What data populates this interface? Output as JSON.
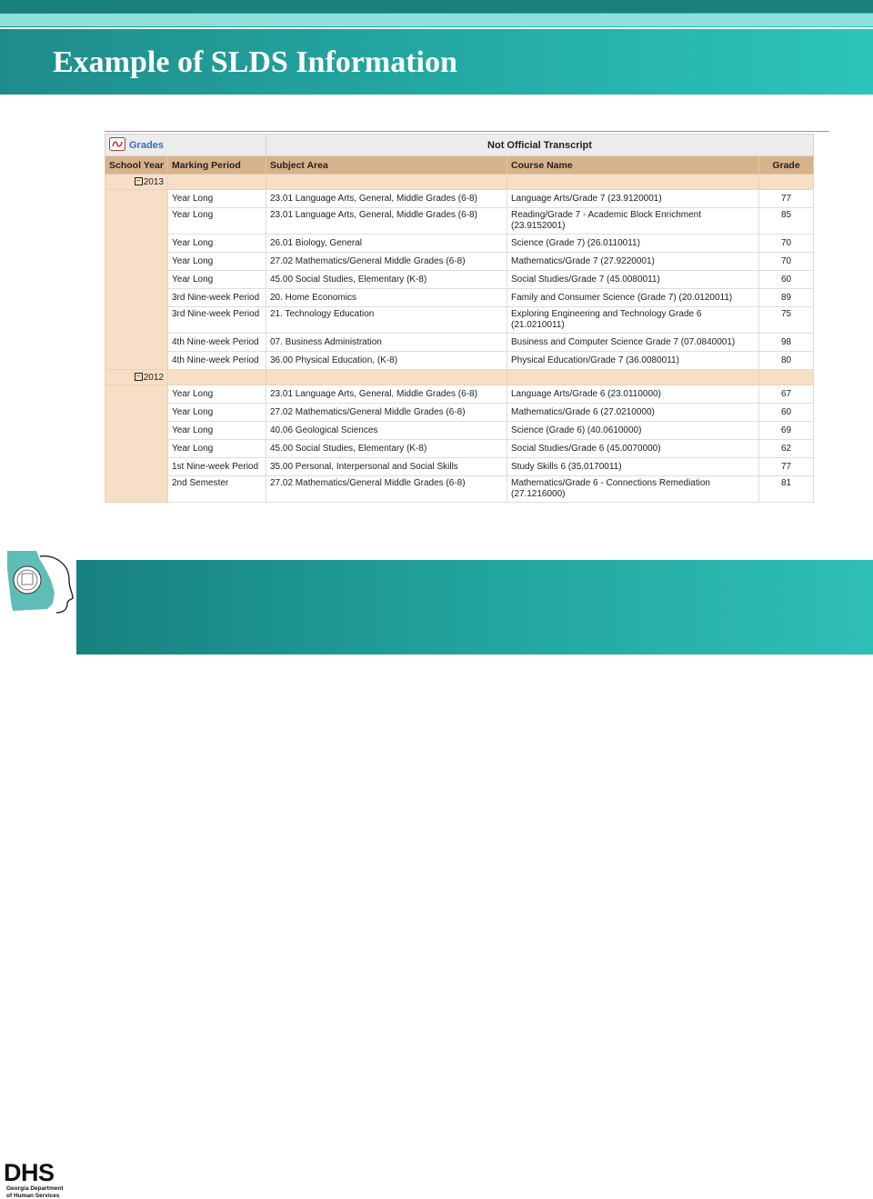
{
  "slide": {
    "title": "Example of SLDS Information"
  },
  "logo": {
    "name": "DHS",
    "org_line1": "Georgia Department",
    "org_line2": "of Human Services"
  },
  "panel": {
    "section_title": "Grades",
    "transcript_label": "Not Official Transcript",
    "columns": [
      "School Year",
      "Marking Period",
      "Subject Area",
      "Course Name",
      "Grade"
    ],
    "years": [
      {
        "year": "2013",
        "rows": [
          {
            "period": "Year Long",
            "subject": "23.01 Language Arts, General, Middle Grades (6-8)",
            "course": "Language Arts/Grade 7 (23.9120001)",
            "grade": "77"
          },
          {
            "period": "Year Long",
            "subject": "23.01 Language Arts, General, Middle Grades (6-8)",
            "course": "Reading/Grade 7 - Academic Block Enrichment (23.9152001)",
            "grade": "85"
          },
          {
            "period": "Year Long",
            "subject": "26.01 Biology, General",
            "course": "Science (Grade 7) (26.0110011)",
            "grade": "70"
          },
          {
            "period": "Year Long",
            "subject": "27.02 Mathematics/General Middle Grades (6-8)",
            "course": "Mathematics/Grade 7 (27.9220001)",
            "grade": "70"
          },
          {
            "period": "Year Long",
            "subject": "45.00 Social Studies, Elementary (K-8)",
            "course": "Social Studies/Grade 7 (45.0080011)",
            "grade": "60"
          },
          {
            "period": "3rd Nine-week Period",
            "subject": "20. Home Economics",
            "course": "Family and Consumer Science (Grade 7) (20.0120011)",
            "grade": "89"
          },
          {
            "period": "3rd Nine-week Period",
            "subject": "21. Technology Education",
            "course": "Exploring Engineering and Technology Grade 6 (21.0210011)",
            "grade": "75"
          },
          {
            "period": "4th Nine-week Period",
            "subject": "07. Business Administration",
            "course": "Business and Computer Science Grade 7 (07.0840001)",
            "grade": "98"
          },
          {
            "period": "4th Nine-week Period",
            "subject": "36.00 Physical Education, (K-8)",
            "course": "Physical Education/Grade 7 (36.0080011)",
            "grade": "80"
          }
        ]
      },
      {
        "year": "2012",
        "rows": [
          {
            "period": "Year Long",
            "subject": "23.01 Language Arts, General, Middle Grades (6-8)",
            "course": "Language Arts/Grade 6 (23.0110000)",
            "grade": "67"
          },
          {
            "period": "Year Long",
            "subject": "27.02 Mathematics/General Middle Grades (6-8)",
            "course": "Mathematics/Grade 6 (27.0210000)",
            "grade": "60"
          },
          {
            "period": "Year Long",
            "subject": "40.06 Geological Sciences",
            "course": "Science (Grade 6) (40.0610000)",
            "grade": "69"
          },
          {
            "period": "Year Long",
            "subject": "45.00 Social Studies, Elementary (K-8)",
            "course": "Social Studies/Grade 6 (45.0070000)",
            "grade": "62"
          },
          {
            "period": "1st Nine-week Period",
            "subject": "35.00 Personal, Interpersonal and Social Skills",
            "course": "Study Skills 6 (35.0170011)",
            "grade": "77"
          },
          {
            "period": "2nd Semester",
            "subject": "27.02 Mathematics/General Middle Grades (6-8)",
            "course": "Mathematics/Grade 6 - Connections Remediation (27.1216000)",
            "grade": "81"
          }
        ]
      }
    ]
  },
  "colors": {
    "header_teal": "#22a6a0",
    "column_header": "#d8b28a",
    "year_row": "#f6dfc6",
    "grades_title": "#3d6ab0"
  }
}
